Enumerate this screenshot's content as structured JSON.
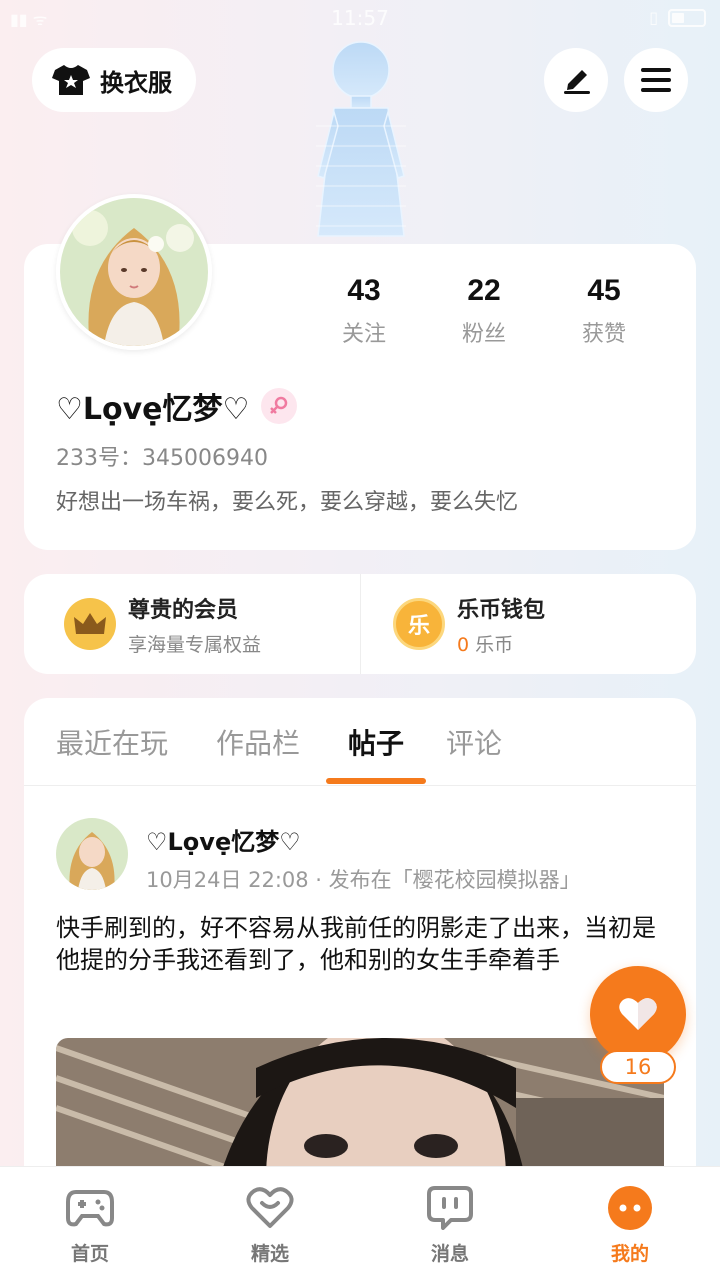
{
  "status_bar": {
    "time": "11:57"
  },
  "header": {
    "dress_button_label": "换衣服"
  },
  "profile": {
    "stats": [
      {
        "value": "43",
        "label": "关注"
      },
      {
        "value": "22",
        "label": "粉丝"
      },
      {
        "value": "45",
        "label": "获赞"
      }
    ],
    "username": "♡Lọvẹ忆梦♡",
    "id_text": "233号：345006940",
    "bio": "好想出一场车祸，要么死，要么穿越，要么失忆"
  },
  "membership": {
    "vip_title": "尊贵的会员",
    "vip_sub": "享海量专属权益",
    "wallet_title": "乐币钱包",
    "wallet_amount": "0",
    "wallet_unit": "乐币",
    "wallet_icon_char": "乐"
  },
  "tabs": [
    "最近在玩",
    "作品栏",
    "帖子",
    "评论"
  ],
  "active_tab": "帖子",
  "post": {
    "author": "♡Lọvẹ忆梦♡",
    "meta": "10月24日 22:08 · 发布在「樱花校园模拟器」",
    "text": "快手刷到的，好不容易从我前任的阴影走了出来，当初是他提的分手我还看到了，他和别的女生手牵着手"
  },
  "like_count": "16",
  "bottom_nav": [
    {
      "label": "首页",
      "icon": "gamepad-icon"
    },
    {
      "label": "精选",
      "icon": "heart-chat-icon"
    },
    {
      "label": "消息",
      "icon": "message-icon"
    },
    {
      "label": "我的",
      "icon": "profile-face-icon"
    }
  ],
  "colors": {
    "accent": "#f57a1c",
    "gold": "#f6c34a"
  }
}
